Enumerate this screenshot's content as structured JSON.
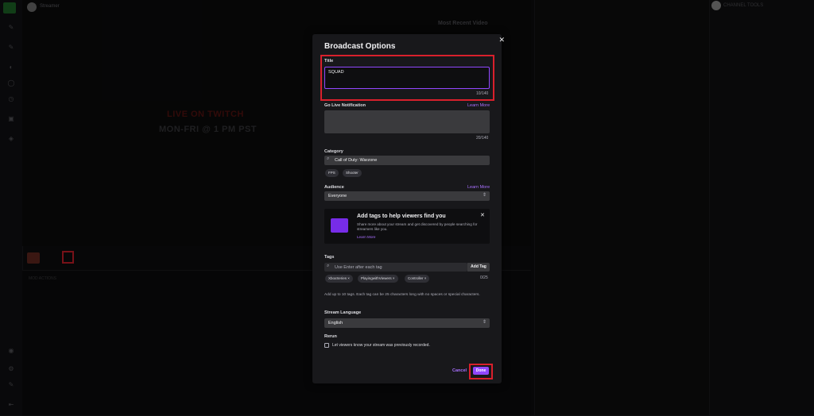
{
  "background": {
    "stream_name": "Streamer",
    "live_text": "LIVE ON TWITCH",
    "schedule_text": "MON-FRI @ 1 PM PST",
    "recent_video_label": "Most Recent Video",
    "channel_tools_label": "CHANNEL TOOLS",
    "bottom_panel_label": "MOD ACTIONS"
  },
  "modal": {
    "title": "Broadcast Options",
    "title_section": {
      "label": "Title",
      "value": "SQUAD",
      "counter": "10/140"
    },
    "go_live": {
      "label": "Go Live Notification",
      "learn_more": "Learn More",
      "counter": "20/140"
    },
    "category": {
      "label": "Category",
      "value": "Call of Duty: Warzone",
      "chips": [
        "FPS",
        "Shooter"
      ]
    },
    "audience": {
      "label": "Audience",
      "learn_more": "Learn More",
      "value": "Everyone"
    },
    "tag_banner": {
      "title": "Add tags to help viewers find you",
      "description": "Share more about your stream and get discovered by people searching for streamers like you.",
      "learn_more": "Learn More"
    },
    "tags": {
      "label": "Tags",
      "placeholder": "Use Enter after each tag",
      "add_button": "Add Tag",
      "chips": [
        "XboxSeries ×",
        "PlayingwithViewers ×",
        "Controller ×"
      ],
      "counter": "0/25",
      "help": "Add up to 10 tags. Each tag can be 25 characters long with no spaces or special characters."
    },
    "language": {
      "label": "Stream Language",
      "value": "English"
    },
    "rerun": {
      "label": "Rerun",
      "checkbox_label": "Let viewers know your stream was previously recorded."
    },
    "cancel_label": "Cancel",
    "done_label": "Done"
  },
  "colors": {
    "accent": "#9147ff",
    "link": "#a970ff",
    "highlight": "#d9202c",
    "modal_bg": "#18181b"
  }
}
